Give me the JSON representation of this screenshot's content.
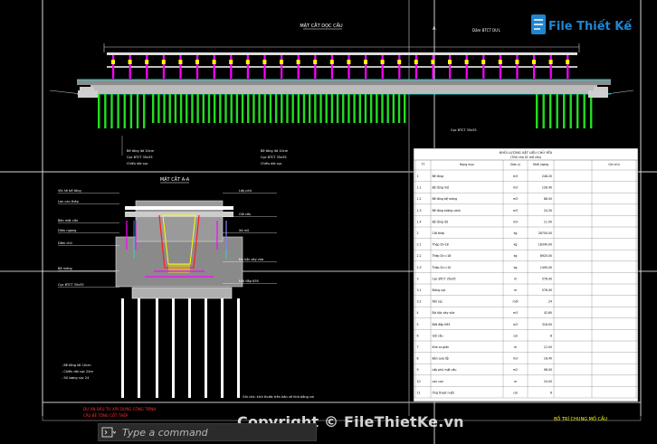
{
  "drawing": {
    "elevation_title": "MẶT CẮT DỌC CẦU",
    "section_title": "MẶT CẮT A-A",
    "section_mark_a": "A",
    "beam_label": "Dầm BTCT DƯL",
    "longitudinal_callouts": [
      "Bê tông lót 10cm",
      "Cọc BTCT 35x35",
      "Chiều dài cọc"
    ],
    "section_labels_left": [
      "Vỉa hè bê tông",
      "Lan can thép",
      "Bản mặt cầu",
      "Dầm ngang",
      "Dầm chủ",
      "Bệ móng",
      "Cọc BTCT 35x35"
    ],
    "section_labels_right": [
      "Lớp phủ",
      "Gối cầu",
      "Xà mũ",
      "Đá hộc xây vữa",
      "Đất đắp K95"
    ],
    "section_notes": [
      "- Bê tông lót 10cm",
      "- Chiều dài cọc 24m",
      "- Số lượng cọc 24"
    ],
    "footer_note": "Ghi chú: kích thước trên bản vẽ tính bằng cm",
    "title_block_left": [
      "DỰ ÁN ĐẦU TƯ XÂY DỰNG CÔNG TRÌNH",
      "CẦU BÊ TÔNG CỐT THÉP"
    ],
    "title_block_right": "BỐ TRÍ CHUNG MỐ CẦU"
  },
  "quantity_table": {
    "title": "KHỐI LƯỢNG VẬT LIỆU CHỦ YẾU",
    "subtitle": "(Tính cho 01 mố cầu)",
    "headers": [
      "TT",
      "Hạng mục",
      "Đơn vị",
      "Khối lượng",
      "Ghi chú"
    ],
    "rows": [
      [
        "1",
        "Bê tông",
        "m3",
        "248.20",
        ""
      ],
      [
        "1.1",
        "Bê tông mố",
        "m3",
        "126.40",
        ""
      ],
      [
        "1.2",
        "Bê tông bệ móng",
        "m3",
        "86.50",
        ""
      ],
      [
        "1.3",
        "Bê tông tường cánh",
        "m3",
        "24.30",
        ""
      ],
      [
        "1.4",
        "Bê tông lót",
        "m3",
        "11.00",
        ""
      ],
      [
        "2",
        "Cốt thép",
        "kg",
        "28750.00",
        ""
      ],
      [
        "2.1",
        "Thép D>18",
        "kg",
        "18340.00",
        ""
      ],
      [
        "2.2",
        "Thép D<=18",
        "kg",
        "8920.00",
        ""
      ],
      [
        "2.3",
        "Thép D<=10",
        "kg",
        "1490.00",
        ""
      ],
      [
        "3",
        "Cọc BTCT 35x35",
        "m",
        "576.00",
        ""
      ],
      [
        "3.1",
        "Đóng cọc",
        "m",
        "576.00",
        ""
      ],
      [
        "3.2",
        "Nối cọc",
        "mối",
        "24",
        ""
      ],
      [
        "4",
        "Đá hộc xây vữa",
        "m3",
        "42.60",
        ""
      ],
      [
        "5",
        "Đất đắp K95",
        "m3",
        "318.00",
        ""
      ],
      [
        "6",
        "Gối cầu",
        "cái",
        "8",
        ""
      ],
      [
        "7",
        "Khe co giãn",
        "m",
        "12.00",
        ""
      ],
      [
        "8",
        "Bản quá độ",
        "m3",
        "18.40",
        ""
      ],
      [
        "9",
        "Lớp phủ mặt cầu",
        "m2",
        "96.00",
        ""
      ],
      [
        "10",
        "Lan can",
        "m",
        "24.00",
        ""
      ],
      [
        "11",
        "Ống thoát nước",
        "cái",
        "6",
        ""
      ]
    ]
  },
  "logo": {
    "brand": "File Thiết Kế",
    "domain": ".vn"
  },
  "command_line": {
    "placeholder": "Type a command"
  },
  "watermark": "Copyright © FileThietKe.vn",
  "colors": {
    "background": "#000000",
    "pile_green": "#22dd22",
    "magenta": "#ff00ff",
    "yellow": "#ffff00",
    "red": "#ff2020",
    "cyan": "#00ffff",
    "table_bg": "#ffffff",
    "logo_blue": "#1f86d1"
  },
  "icons": {
    "command_menu": "chevron-menu-icon",
    "watermark": "copyright-icon"
  }
}
